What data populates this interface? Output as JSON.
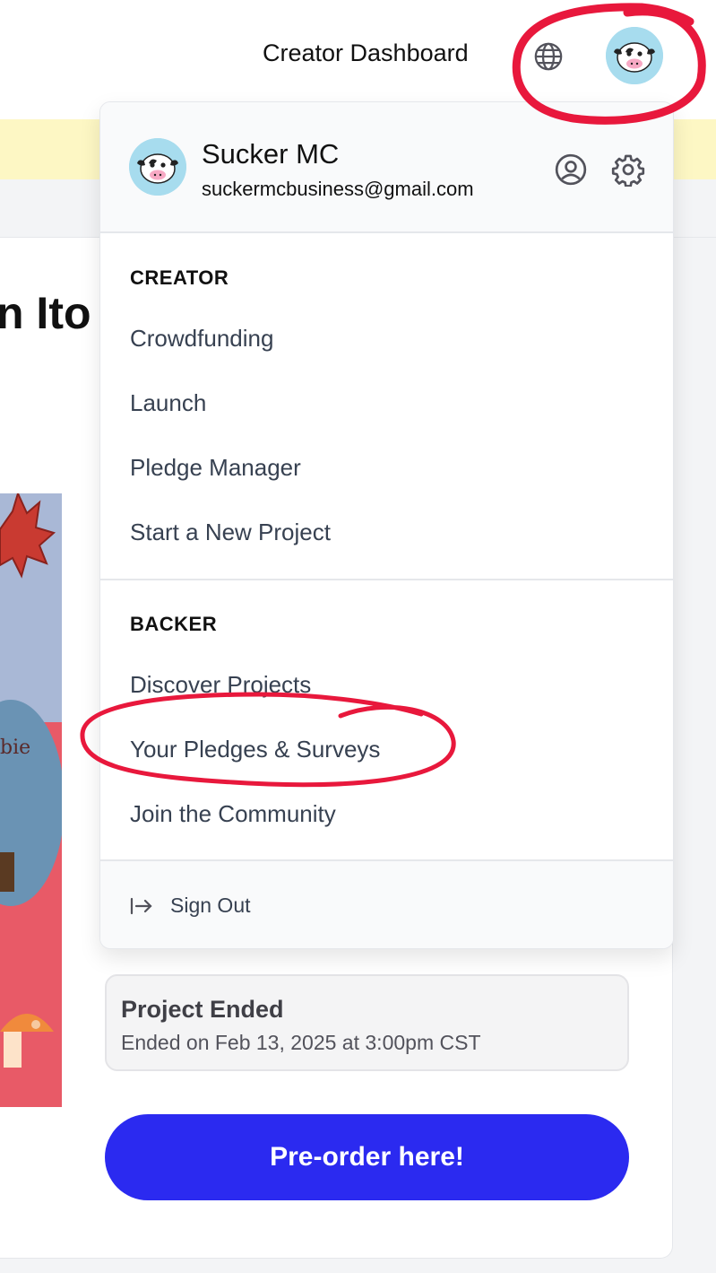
{
  "header": {
    "creator_dashboard": "Creator Dashboard",
    "icons": [
      "globe-icon",
      "avatar"
    ]
  },
  "page": {
    "title_fragment": "n Ito",
    "art_text": "bie",
    "status": {
      "title": "Project Ended",
      "subtitle": "Ended on Feb 13, 2025 at 3:00pm CST"
    },
    "cta_label": "Pre-order here!"
  },
  "menu": {
    "user": {
      "name": "Sucker MC",
      "email": "suckermcbusiness@gmail.com",
      "icons": [
        "user-circle-icon",
        "gear-icon"
      ]
    },
    "creator": {
      "heading": "CREATOR",
      "items": [
        "Crowdfunding",
        "Launch",
        "Pledge Manager",
        "Start a New Project"
      ]
    },
    "backer": {
      "heading": "BACKER",
      "items": [
        "Discover Projects",
        "Your Pledges & Surveys",
        "Join the Community"
      ]
    },
    "sign_out": "Sign Out"
  },
  "colors": {
    "accent_button": "#2b2af0",
    "banner": "#fdf7c4",
    "annotation": "#e8183c"
  }
}
